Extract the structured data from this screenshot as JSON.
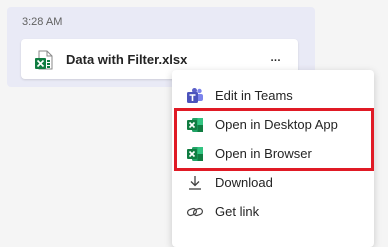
{
  "message": {
    "timestamp": "3:28 AM",
    "attachment": {
      "file_name": "Data with Filter.xlsx",
      "icon": "excel-file-icon",
      "more_label": "..."
    }
  },
  "context_menu": {
    "items": [
      {
        "label": "Edit in Teams",
        "icon": "teams-icon"
      },
      {
        "label": "Open in Desktop App",
        "icon": "excel-icon"
      },
      {
        "label": "Open in Browser",
        "icon": "excel-icon"
      },
      {
        "label": "Download",
        "icon": "download-icon"
      },
      {
        "label": "Get link",
        "icon": "link-icon"
      }
    ]
  },
  "colors": {
    "bubble": "#e9eaf6",
    "excel_green": "#107c41",
    "teams_purple": "#5b5fc7",
    "highlight_red": "#e01a25"
  }
}
